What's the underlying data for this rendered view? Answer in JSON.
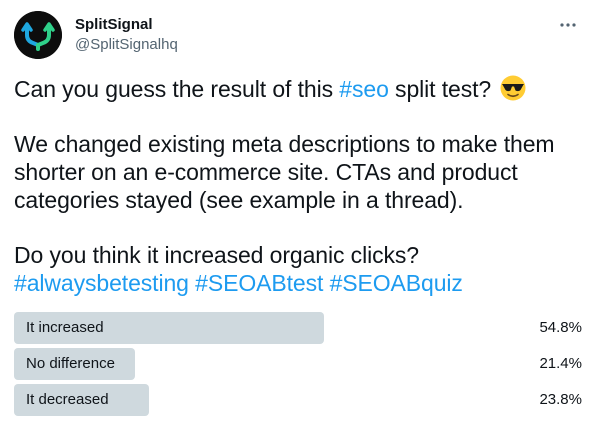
{
  "author": {
    "display_name": "SplitSignal",
    "handle": "@SplitSignalhq",
    "avatar_icon": "splitsignal-logo",
    "avatar_colors": [
      "#0d0d0d",
      "#1fa8e0",
      "#2fd18a"
    ]
  },
  "tweet": {
    "line1_text": "Can you guess the result of this ",
    "line1_hashtag": "#seo",
    "line1_after": " split test?",
    "emoji": "smiling-face-with-sunglasses",
    "line2": "We changed existing meta descriptions to make them",
    "line3": "shorter on an e-commerce site. CTAs and product",
    "line4": "categories stayed (see example in a thread).",
    "line5": "Do you think it increased organic clicks?",
    "hashtags": [
      "#alwaysbetesting",
      "#SEOABtest",
      "#SEOABquiz"
    ]
  },
  "poll": {
    "options": [
      {
        "label": "It increased",
        "percent_text": "54.8%",
        "percent": 54.8
      },
      {
        "label": "No difference",
        "percent_text": "21.4%",
        "percent": 21.4
      },
      {
        "label": "It decreased",
        "percent_text": "23.8%",
        "percent": 23.8
      }
    ]
  },
  "colors": {
    "hashtag": "#1d9bf0",
    "bar": "#cfd9de",
    "text": "#0f1419",
    "muted": "#536471"
  }
}
